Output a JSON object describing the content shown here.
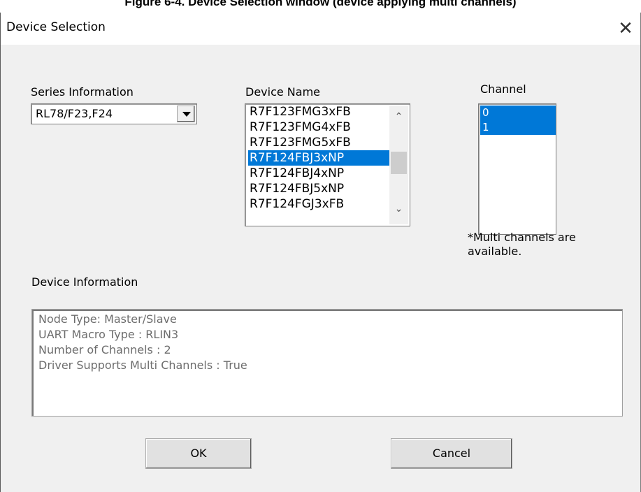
{
  "figure_caption": "Figure 6-4. Device Selection window (device applying multi channels)",
  "window": {
    "title": "Device Selection",
    "close_glyph": "✕"
  },
  "series": {
    "label": "Series Information",
    "selected": "RL78/F23,F24"
  },
  "device": {
    "label": "Device Name",
    "items": [
      "R7F123FMG3xFB",
      "R7F123FMG4xFB",
      "R7F123FMG5xFB",
      "R7F124FBJ3xNP",
      "R7F124FBJ4xNP",
      "R7F124FBJ5xNP",
      "R7F124FGJ3xFB"
    ],
    "selected_index": 3
  },
  "channel": {
    "label": "Channel",
    "items": [
      "0",
      "1"
    ],
    "note": "*Multi channels are available."
  },
  "device_info": {
    "label": "Device Information",
    "lines": [
      "Node Type: Master/Slave",
      "UART Macro Type : RLIN3",
      "Number of Channels : 2",
      "Driver Supports Multi Channels : True"
    ]
  },
  "buttons": {
    "ok": "OK",
    "cancel": "Cancel"
  },
  "colors": {
    "selection": "#0078d7",
    "dialog_bg": "#f0f0f0"
  }
}
